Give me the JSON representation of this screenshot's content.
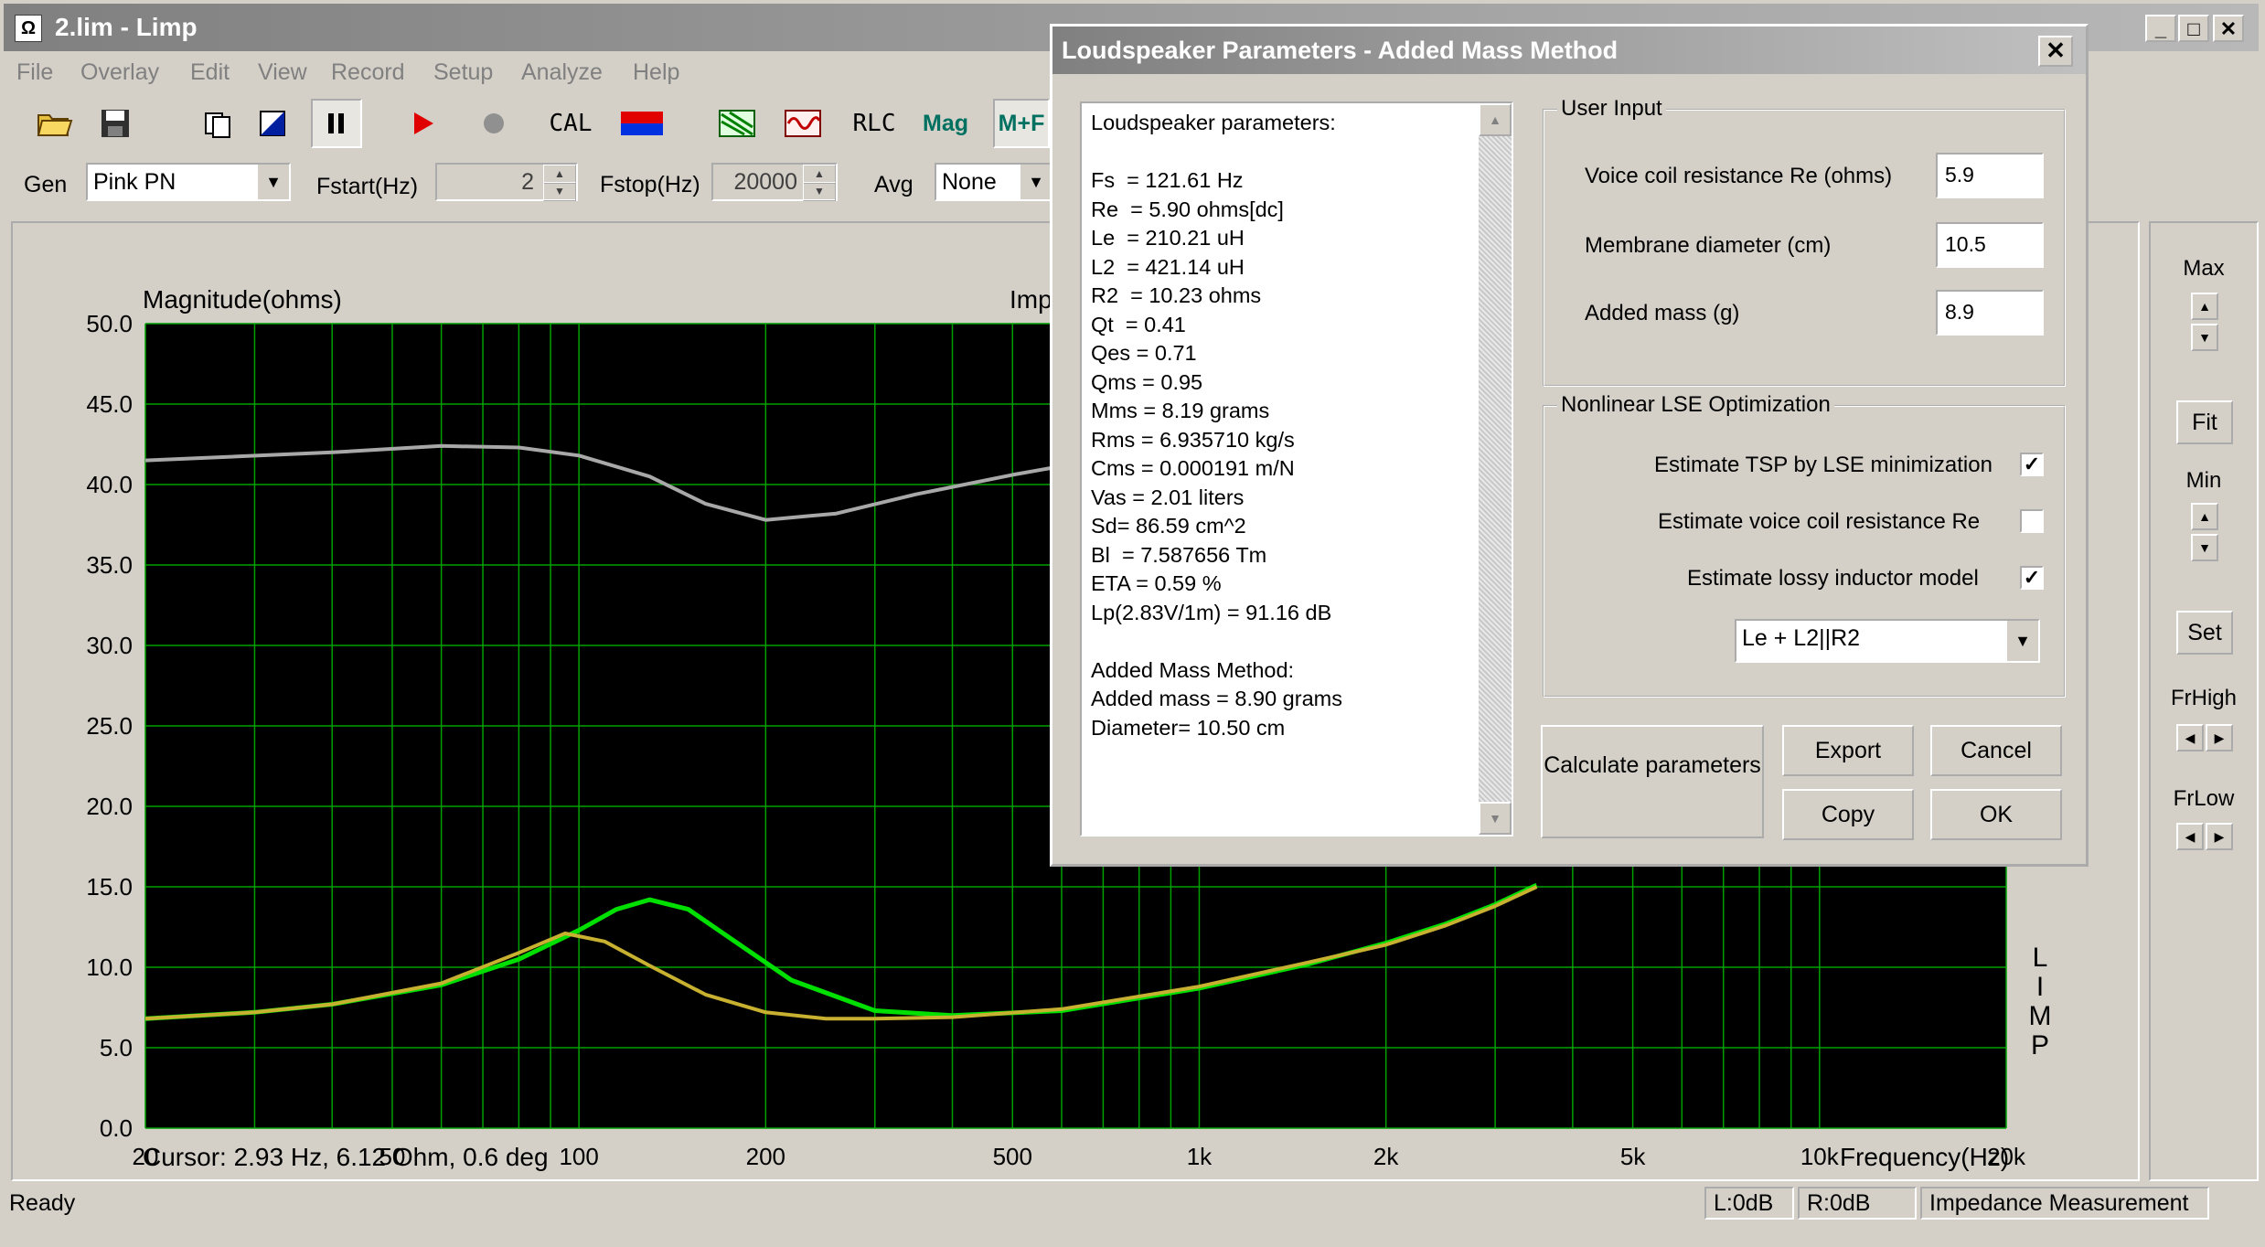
{
  "window": {
    "title": "2.lim - Limp",
    "app_icon": "Ω",
    "minimize": "_",
    "maximize": "□",
    "close": "✕"
  },
  "menu": [
    "File",
    "Overlay",
    "Edit",
    "View",
    "Record",
    "Setup",
    "Analyze",
    "Help"
  ],
  "toolbar": {
    "cal_label": "CAL",
    "rlc_label": "RLC",
    "mag_label": "Mag",
    "mphase_label": "M+F"
  },
  "gen_bar": {
    "gen_label": "Gen",
    "gen_value": "Pink PN",
    "fstart_label": "Fstart(Hz)",
    "fstart_value": "2",
    "fstop_label": "Fstop(Hz)",
    "fstop_value": "20000",
    "avg_label": "Avg",
    "avg_value": "None"
  },
  "plot": {
    "ylabel": "Magnitude(ohms)",
    "title_partial": "Imp",
    "xlabel": "Frequency(Hz)",
    "cursor": "Cursor: 2.93 Hz, 6.12 Ohm, 0.6 deg",
    "right_label": [
      "L",
      "I",
      "M",
      "P"
    ]
  },
  "chart_data": {
    "type": "line",
    "xscale": "log",
    "xlim": [
      20,
      20000
    ],
    "ylim": [
      0,
      50
    ],
    "grid": true,
    "yticks": [
      "50.0",
      "45.0",
      "40.0",
      "35.0",
      "30.0",
      "25.0",
      "20.0",
      "15.0",
      "10.0",
      "5.0",
      "0.0"
    ],
    "xticks": [
      "20",
      "50",
      "100",
      "200",
      "500",
      "1k",
      "2k",
      "5k",
      "10k",
      "20k"
    ],
    "series": [
      {
        "color": "#a8a8a8",
        "x": [
          20,
          40,
          60,
          80,
          100,
          130,
          160,
          200,
          260,
          350,
          500,
          700
        ],
        "y": [
          41.5,
          42.0,
          42.4,
          42.3,
          41.8,
          40.5,
          38.8,
          37.8,
          38.2,
          39.4,
          40.6,
          41.6
        ]
      },
      {
        "color": "#00e000",
        "x": [
          20,
          30,
          40,
          60,
          80,
          100,
          115,
          130,
          150,
          180,
          220,
          300,
          400,
          600,
          1000,
          1500,
          2000,
          2500,
          3000,
          3500
        ],
        "y": [
          6.8,
          7.2,
          7.7,
          8.9,
          10.5,
          12.3,
          13.6,
          14.2,
          13.6,
          11.5,
          9.2,
          7.3,
          7.0,
          7.3,
          8.7,
          10.2,
          11.5,
          12.7,
          13.9,
          15.1
        ]
      },
      {
        "color": "#c8b030",
        "x": [
          20,
          30,
          40,
          60,
          80,
          95,
          110,
          130,
          160,
          200,
          250,
          300,
          400,
          600,
          1000,
          1500,
          2000,
          2500,
          3000,
          3500
        ],
        "y": [
          6.8,
          7.2,
          7.7,
          9.0,
          10.9,
          12.1,
          11.6,
          10.1,
          8.3,
          7.2,
          6.8,
          6.8,
          6.9,
          7.4,
          8.8,
          10.3,
          11.4,
          12.6,
          13.8,
          15.0
        ]
      }
    ]
  },
  "right_panel": {
    "max": "Max",
    "fit": "Fit",
    "min": "Min",
    "set": "Set",
    "frhigh": "FrHigh",
    "frlow": "FrLow"
  },
  "status": {
    "ready": "Ready",
    "l": "L:0dB",
    "r": "R:0dB",
    "mode": "Impedance Measurement"
  },
  "dialog": {
    "title": "Loudspeaker Parameters - Added Mass Method",
    "close": "✕",
    "text_lines": [
      "Loudspeaker parameters:",
      "",
      "Fs  = 121.61 Hz",
      "Re  = 5.90 ohms[dc]",
      "Le  = 210.21 uH",
      "L2  = 421.14 uH",
      "R2  = 10.23 ohms",
      "Qt  = 0.41",
      "Qes = 0.71",
      "Qms = 0.95",
      "Mms = 8.19 grams",
      "Rms = 6.935710 kg/s",
      "Cms = 0.000191 m/N",
      "Vas = 2.01 liters",
      "Sd= 86.59 cm^2",
      "Bl  = 7.587656 Tm",
      "ETA = 0.59 %",
      "Lp(2.83V/1m) = 91.16 dB",
      "",
      "Added Mass Method:",
      "Added mass = 8.90 grams",
      "Diameter= 10.50 cm"
    ],
    "user_input": {
      "label": "User Input",
      "re_label": "Voice coil resistance Re (ohms)",
      "re_value": "5.9",
      "diam_label": "Membrane diameter (cm)",
      "diam_value": "10.5",
      "mass_label": "Added mass (g)",
      "mass_value": "8.9"
    },
    "lse": {
      "label": "Nonlinear LSE Optimization",
      "tsp_label": "Estimate TSP by LSE minimization",
      "tsp_checked": true,
      "re_label": "Estimate voice coil resistance Re",
      "re_checked": false,
      "lossy_label": "Estimate lossy inductor model",
      "lossy_checked": true,
      "model_value": "Le + L2||R2"
    },
    "buttons": {
      "calculate": "Calculate parameters",
      "export": "Export",
      "cancel": "Cancel",
      "copy": "Copy",
      "ok": "OK"
    }
  }
}
